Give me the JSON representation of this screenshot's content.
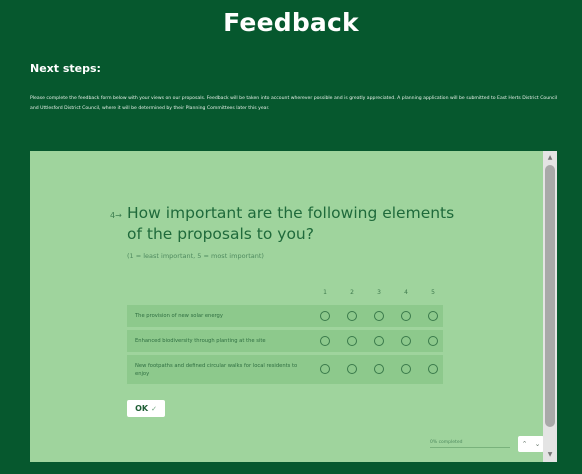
{
  "page": {
    "title": "Feedback",
    "section_heading": "Next steps:",
    "intro_text": "Please complete the feedback form below with your views on our proposals. Feedback will be taken into account wherever possible and is greatly appreciated. A planning application will be submitted to East Herts District Council and Uttlesford District Council, where it will be determined by their Planning Committees later this year."
  },
  "form": {
    "question_number": "4",
    "question_arrow": "→",
    "question_title": "How important are the following elements of the proposals to you?",
    "question_subtitle": "(1 = least important, 5 = most important)",
    "scale": [
      "1",
      "2",
      "3",
      "4",
      "5"
    ],
    "rows": [
      {
        "label": "The provision of new solar energy"
      },
      {
        "label": "Enhanced biodiversity through planting at the site"
      },
      {
        "label": "New footpaths and defined circular walks for local residents to enjoy"
      }
    ],
    "ok_label": "OK",
    "ok_icon": "✓",
    "progress_text": "0% completed",
    "progress_fraction": 0.0,
    "nav_up": "⌃",
    "nav_down": "⌄"
  },
  "colors": {
    "page_background": "#06582e",
    "form_background": "#9fd49d",
    "accent": "#1f6a3b"
  },
  "icons": {
    "scroll_up": "▲",
    "scroll_down": "▼"
  }
}
